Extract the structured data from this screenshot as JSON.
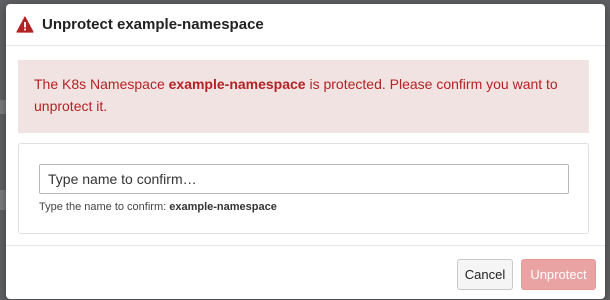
{
  "modal": {
    "title": "Unprotect example-namespace",
    "alert": {
      "prefix": "The K8s Namespace ",
      "name": "example-namespace",
      "suffix": " is protected. Please confirm you want to unprotect it."
    },
    "input": {
      "placeholder": "Type name to confirm…",
      "value": ""
    },
    "hint": {
      "label": "Type the name to confirm: ",
      "name": "example-namespace"
    },
    "buttons": {
      "cancel": "Cancel",
      "unprotect": "Unprotect"
    }
  },
  "colors": {
    "alert_bg": "#f2e3e3",
    "alert_text": "#b52224",
    "warning_icon": "#b52224",
    "unprotect_disabled": "#eaa3a3"
  },
  "icons": {
    "header": "warning-triangle-icon"
  }
}
